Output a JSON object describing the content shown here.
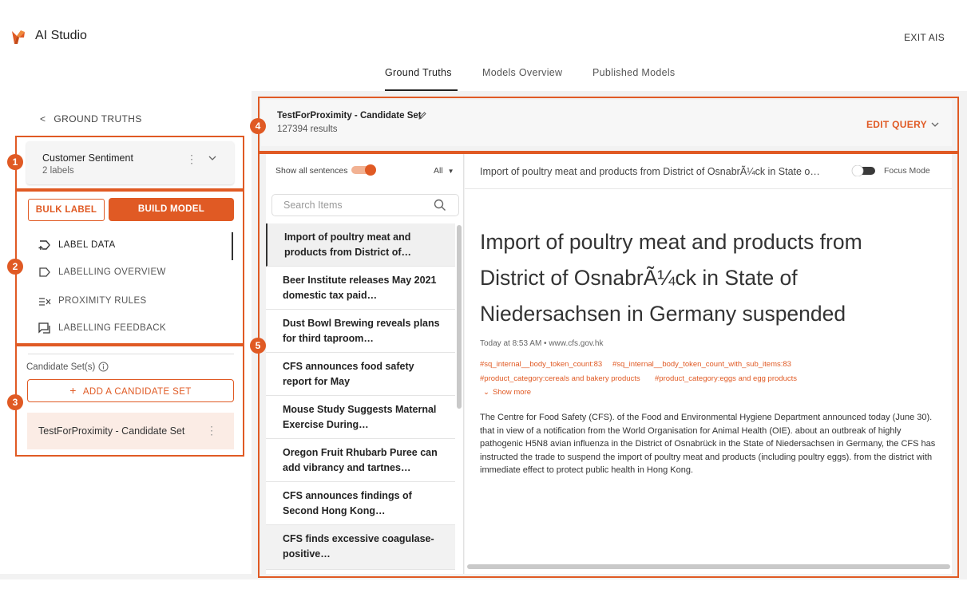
{
  "app": {
    "title": "AI Studio",
    "exit_label": "EXIT AIS"
  },
  "tabs": [
    {
      "label": "Ground Truths",
      "active": true
    },
    {
      "label": "Models Overview",
      "active": false
    },
    {
      "label": "Published Models",
      "active": false
    }
  ],
  "sidebar": {
    "back_label": "GROUND TRUTHS",
    "dataset": {
      "name": "Customer Sentiment",
      "subtitle": "2 labels"
    },
    "buttons": {
      "bulk_label": "BULK LABEL",
      "build_model": "BUILD MODEL"
    },
    "nav_items": [
      {
        "label": "LABEL DATA",
        "icon": "label-data-icon",
        "active": true
      },
      {
        "label": "LABELLING OVERVIEW",
        "icon": "label-tag-icon",
        "active": false
      },
      {
        "label": "PROXIMITY RULES",
        "icon": "proximity-rules-icon",
        "active": false
      },
      {
        "label": "LABELLING FEEDBACK",
        "icon": "feedback-icon",
        "active": false
      }
    ],
    "candidate_sets": {
      "title": "Candidate Set(s)",
      "add_label": "ADD A CANDIDATE SET",
      "items": [
        {
          "label": "TestForProximity - Candidate Set"
        }
      ]
    }
  },
  "callouts": [
    "1",
    "2",
    "3",
    "4",
    "5"
  ],
  "header": {
    "set_title": "TestForProximity - Candidate Set",
    "result_count": "127394 results",
    "edit_query_label": "EDIT QUERY"
  },
  "list": {
    "show_all_label": "Show all sentences",
    "show_all_on": true,
    "filter_value": "All",
    "search_placeholder": "Search Items",
    "items": [
      {
        "text": "Import of poultry meat and products from District of…"
      },
      {
        "text": "Beer Institute releases May 2021 domestic tax paid…"
      },
      {
        "text": "Dust Bowl Brewing reveals plans for third taproom…"
      },
      {
        "text": "CFS announces food safety report for May"
      },
      {
        "text": "Mouse Study Suggests Maternal Exercise During…"
      },
      {
        "text": "Oregon Fruit Rhubarb Puree can add vibrancy and tartnes…"
      },
      {
        "text": "CFS announces findings of Second Hong Kong…"
      },
      {
        "text": "CFS finds excessive coagulase-positive…"
      }
    ]
  },
  "detail": {
    "header_title": "Import of poultry meat and products from District of OsnabrÃ¼ck in State o…",
    "focus_mode_label": "Focus Mode",
    "focus_mode_on": false,
    "doc_title": "Import of poultry meat and products from District of OsnabrÃ¼ck in State of Niedersachsen in Germany suspended",
    "meta": "Today at 8:53 AM  •  www.cfs.gov.hk",
    "tags": [
      "#sq_internal__body_token_count:83",
      "#sq_internal__body_token_count_with_sub_items:83",
      "#product_category:cereals and bakery products",
      "#product_category:eggs and egg products"
    ],
    "show_more_label": "Show more",
    "body": "The Centre for Food Safety (CFS). of the Food and Environmental Hygiene Department announced today (June 30). that in view of a notification from the World Organisation for Animal Health (OIE). about an outbreak of highly pathogenic H5N8 avian influenza in the District of Osnabrück in the State of Niedersachsen in Germany, the CFS has instructed the trade to suspend the import of poultry meat and products (including poultry eggs). from the district with immediate effect to protect public health in Hong Kong."
  },
  "colors": {
    "accent": "#e05a24",
    "selected_bg": "#fbece5",
    "panel_bg": "#f2f2f2"
  }
}
